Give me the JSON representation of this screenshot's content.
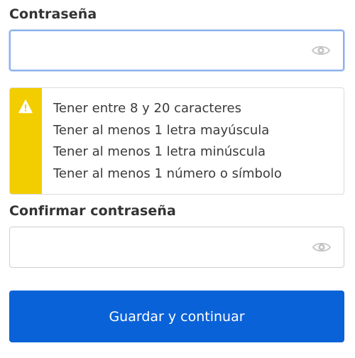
{
  "password": {
    "label": "Contraseña",
    "value": "",
    "placeholder": "",
    "toggle_icon": "eye-icon",
    "focused": true
  },
  "requirements": {
    "icon": "warning-icon",
    "accent_color": "#f2cd00",
    "items": [
      "Tener entre 8 y 20 caracteres",
      "Tener al menos 1 letra mayúscula",
      "Tener al menos 1 letra minúscula",
      "Tener al menos 1 número o símbolo"
    ]
  },
  "confirm_password": {
    "label": "Confirmar contraseña",
    "value": "",
    "placeholder": "",
    "toggle_icon": "eye-icon"
  },
  "submit": {
    "label": "Guardar y continuar",
    "color": "#0a62d8"
  }
}
